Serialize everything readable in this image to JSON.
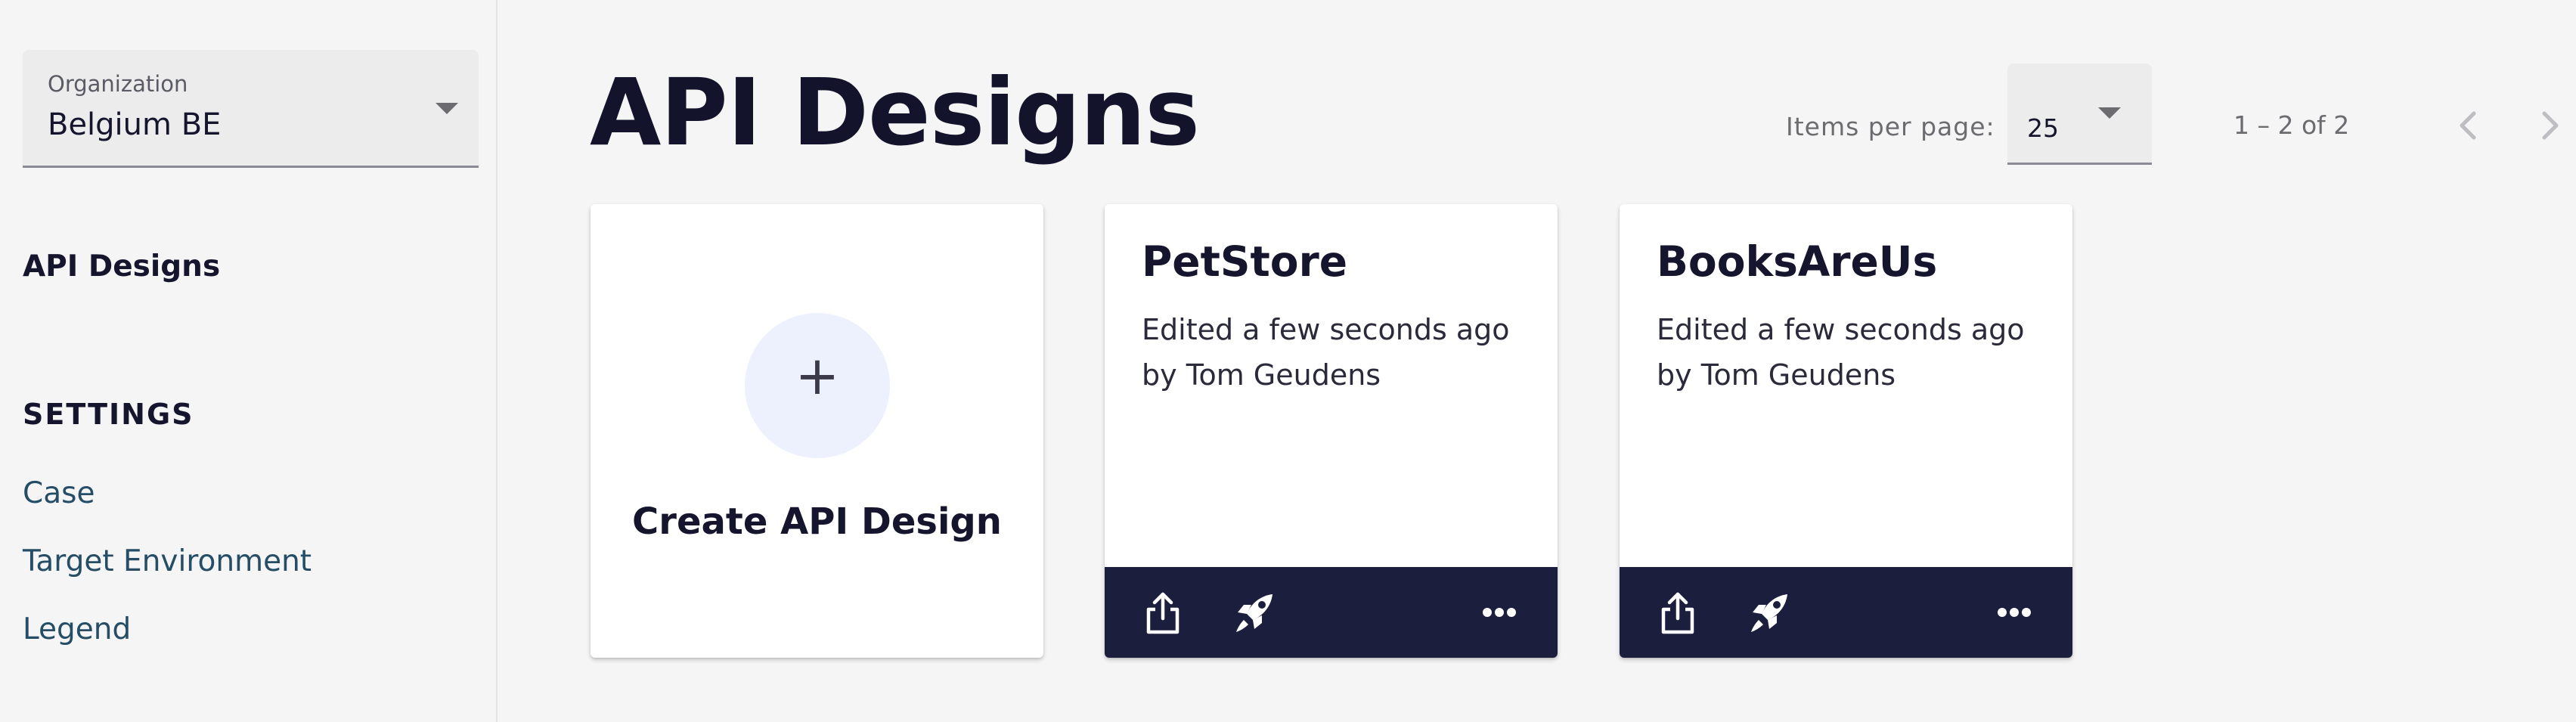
{
  "sidebar": {
    "organization": {
      "label": "Organization",
      "value": "Belgium BE"
    },
    "nav_active": "API Designs",
    "settings_heading": "SETTINGS",
    "settings_items": [
      "Case",
      "Target Environment",
      "Legend"
    ]
  },
  "main": {
    "title": "API Designs",
    "pagination": {
      "items_per_page_label": "Items per page:",
      "items_per_page_value": "25",
      "range_label": "1 – 2 of 2"
    },
    "create_card": {
      "plus": "+",
      "label": "Create API Design"
    },
    "cards": [
      {
        "title": "PetStore",
        "edited": "Edited a few seconds ago by Tom Geudens"
      },
      {
        "title": "BooksAreUs",
        "edited": "Edited a few seconds ago by Tom Geudens"
      }
    ]
  },
  "icons": [
    "chevron-down-icon",
    "chevron-left-icon",
    "chevron-right-icon",
    "plus-icon",
    "share-icon",
    "rocket-icon",
    "more-horizontal-icon"
  ],
  "colors": {
    "card_footer": "#1c1e3d",
    "title_text": "#15152e",
    "create_circle": "#edf1fd",
    "background": "#f5f5f5"
  }
}
